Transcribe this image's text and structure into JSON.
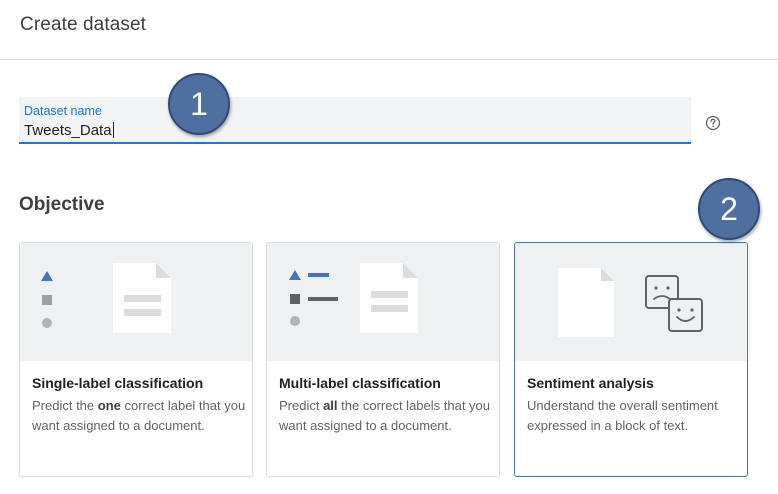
{
  "header": {
    "title": "Create dataset"
  },
  "dataset_name": {
    "label": "Dataset name",
    "value": "Tweets_Data"
  },
  "help_icon": "help-circle-icon",
  "objective": {
    "heading": "Objective"
  },
  "cards": [
    {
      "title": "Single-label classification",
      "desc_pre": "Predict the ",
      "desc_bold": "one",
      "desc_post": " correct label that you want assigned to a document.",
      "selected": false
    },
    {
      "title": "Multi-label classification",
      "desc_pre": "Predict ",
      "desc_bold": "all",
      "desc_post": " the correct labels that you want assigned to a document.",
      "selected": false
    },
    {
      "title": "Sentiment analysis",
      "desc_pre": "Understand the overall sentiment expressed in a block of text.",
      "desc_bold": "",
      "desc_post": "",
      "selected": true
    }
  ],
  "callouts": [
    {
      "number": "1"
    },
    {
      "number": "2"
    }
  ],
  "colors": {
    "accent": "#1a73e8",
    "selected_border": "#4a76a8",
    "callout": "#4f6fa0",
    "illustration": "#4472c4"
  }
}
